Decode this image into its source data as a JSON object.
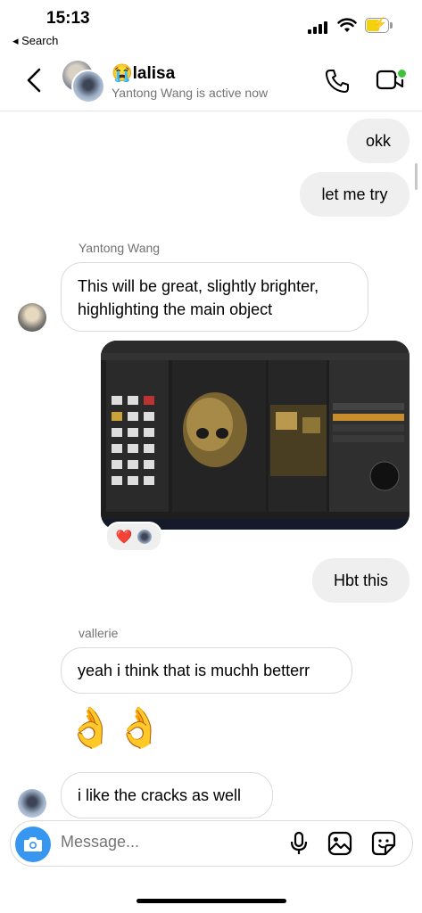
{
  "status_bar": {
    "time": "15:13",
    "back_app": "◂ Search"
  },
  "header": {
    "contact_name": "😭lalisa",
    "status": "Yantong Wang is active now",
    "call_icon": "phone-icon",
    "video_icon": "video-icon",
    "active_color": "#3ec23a"
  },
  "messages": {
    "m1": "okk",
    "m2": "let me try",
    "sender1": "Yantong Wang",
    "m3": "This will be great, slightly brighter, highlighting the main object",
    "reactions": "❤️",
    "m4": "Hbt this",
    "sender2": "vallerie",
    "m5": "yeah i think that is muchh betterr",
    "emoji_msg": "👌👌",
    "m6": "i like the cracks as well"
  },
  "composer": {
    "placeholder": "Message...",
    "accent": "#3797f0"
  }
}
